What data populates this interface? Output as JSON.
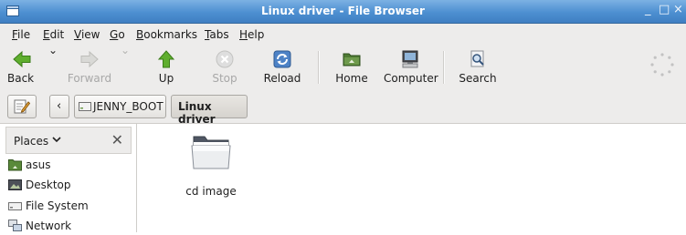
{
  "window": {
    "title": "Linux driver - File Browser",
    "controls": [
      "_",
      "□",
      "×"
    ]
  },
  "menu": [
    "File",
    "Edit",
    "View",
    "Go",
    "Bookmarks",
    "Tabs",
    "Help"
  ],
  "toolbar": {
    "back": "Back",
    "forward": "Forward",
    "up": "Up",
    "stop": "Stop",
    "reload": "Reload",
    "home": "Home",
    "computer": "Computer",
    "search": "Search"
  },
  "pathbar": {
    "prev": "‹",
    "crumbs": [
      "JENNY_BOOT",
      "Linux driver"
    ]
  },
  "sidebar": {
    "header": "Places",
    "close": "✕",
    "items": [
      "asus",
      "Desktop",
      "File System",
      "Network"
    ]
  },
  "content": {
    "files": [
      "cd image"
    ]
  },
  "colors": {
    "titlebar": "#4d8fd1",
    "toolbar_bg": "#edeceb",
    "active_crumb": "#dad7d2"
  }
}
